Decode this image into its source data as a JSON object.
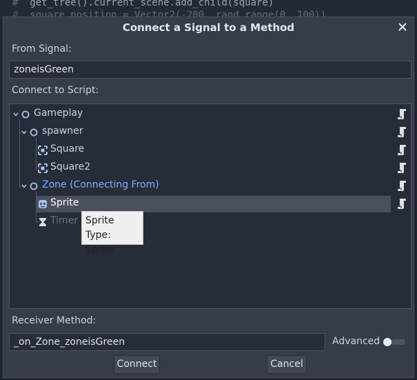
{
  "background_code": {
    "line1_comment": "#",
    "line1": "get_tree().current_scene.add_child(square)",
    "line2_comment": "#",
    "line2": "square.position = Vector2(-200, rand_range(0, 100))"
  },
  "dialog": {
    "title": "Connect a Signal to a Method",
    "from_signal_label": "From Signal:",
    "from_signal_value": "zoneisGreen",
    "connect_to_script_label": "Connect to Script:",
    "receiver_method_label": "Receiver Method:",
    "receiver_method_value": "_on_Zone_zoneisGreen",
    "advanced_label": "Advanced",
    "advanced_enabled": false,
    "connect_button": "Connect",
    "cancel_button": "Cancel"
  },
  "tree": {
    "nodes": [
      {
        "label": "Gameplay",
        "icon": "node-circle-icon",
        "expanded": true
      },
      {
        "label": "spawner",
        "icon": "node-circle-icon",
        "expanded": true
      },
      {
        "label": "Square",
        "icon": "node2d-icon"
      },
      {
        "label": "Square2",
        "icon": "node2d-icon"
      },
      {
        "label": "Zone (Connecting From)",
        "icon": "node-circle-icon",
        "expanded": true,
        "color": "#7fb0ff"
      },
      {
        "label": "Sprite",
        "icon": "sprite-icon",
        "selected": true
      },
      {
        "label": "Timer",
        "icon": "hourglass-icon",
        "disabled": true
      }
    ]
  },
  "tooltip": {
    "line1": "Sprite",
    "line2": "Type: Sprite"
  },
  "colors": {
    "accent_blue": "#7fb0ff",
    "node_circle": "#9fb4dc",
    "dialog_bg": "#353c4a"
  }
}
